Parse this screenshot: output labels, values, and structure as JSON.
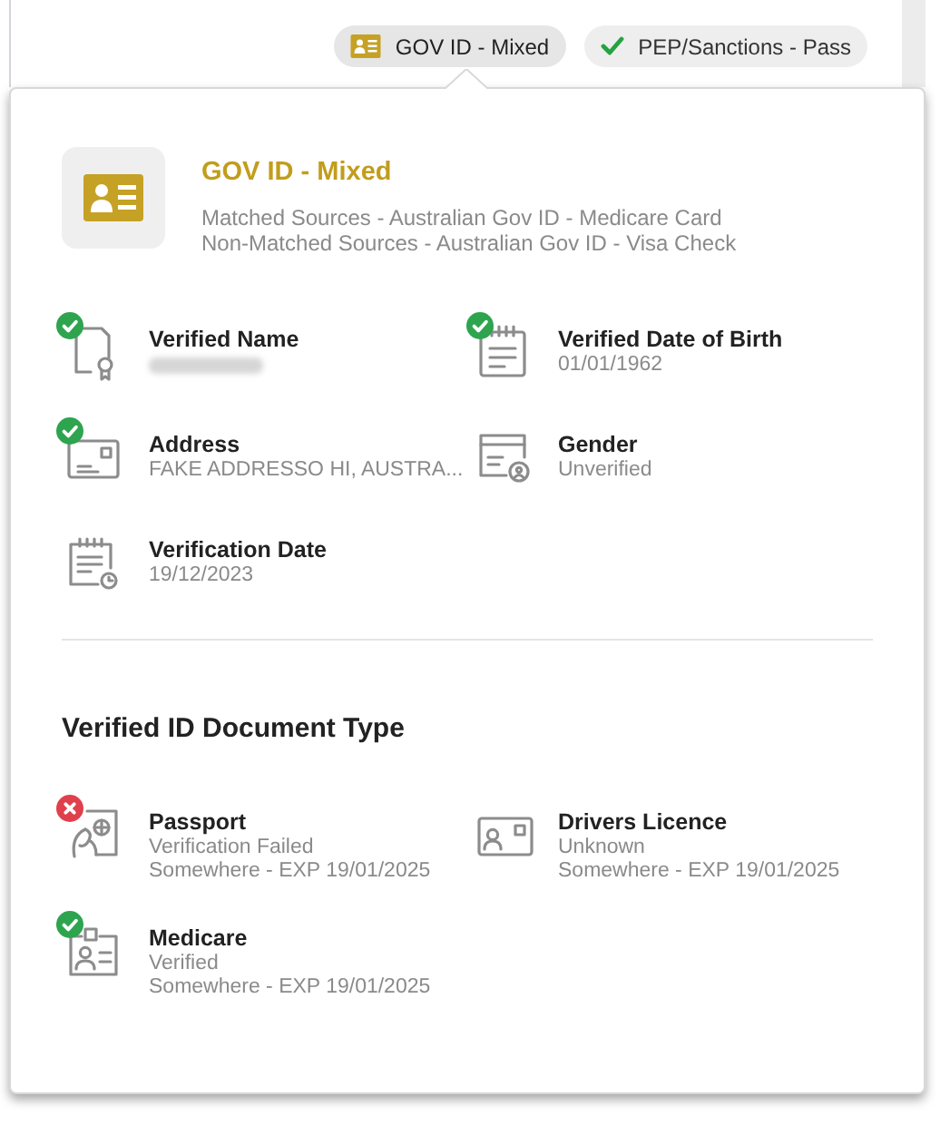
{
  "status_pills": [
    {
      "label": "GOV ID - Mixed",
      "kind": "card",
      "selected": true
    },
    {
      "label": "PEP/Sanctions - Pass",
      "kind": "tick",
      "selected": false
    }
  ],
  "header": {
    "title": "GOV ID - Mixed",
    "lines": [
      "Matched Sources - Australian Gov ID - Medicare Card",
      "Non-Matched Sources - Australian Gov ID - Visa Check"
    ]
  },
  "fields": [
    {
      "kind": "certificate",
      "verified": true,
      "failed": false,
      "label": "Verified Name",
      "redacted": true
    },
    {
      "kind": "calendar",
      "verified": true,
      "failed": false,
      "label": "Verified Date of Birth",
      "value": "01/01/1962"
    },
    {
      "kind": "address",
      "verified": true,
      "failed": false,
      "label": "Address",
      "value": "FAKE ADDRESSO HI, AUSTRA..."
    },
    {
      "kind": "person",
      "verified": false,
      "failed": false,
      "label": "Gender",
      "value": "Unverified"
    },
    {
      "kind": "schedule",
      "verified": false,
      "failed": false,
      "label": "Verification Date",
      "value": "19/12/2023"
    }
  ],
  "documents": {
    "title": "Verified ID Document Type",
    "items": [
      {
        "kind": "passport",
        "verified": false,
        "failed": true,
        "label": "Passport",
        "lines": [
          "Verification Failed",
          "Somewhere - EXP 19/01/2025"
        ]
      },
      {
        "kind": "licence",
        "verified": false,
        "failed": false,
        "label": "Drivers Licence",
        "lines": [
          "Unknown",
          "Somewhere - EXP 19/01/2025"
        ]
      },
      {
        "kind": "badge",
        "verified": true,
        "failed": false,
        "label": "Medicare",
        "lines": [
          "Verified",
          "Somewhere - EXP 19/01/2025"
        ]
      }
    ]
  }
}
